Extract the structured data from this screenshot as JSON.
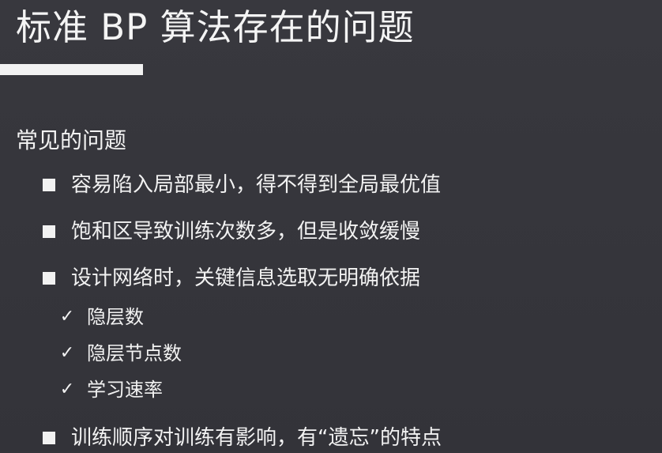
{
  "slide": {
    "title": "标准 BP 算法存在的问题",
    "section_heading": "常见的问题",
    "bullets": [
      {
        "text": "容易陷入局部最小，得不得到全局最优值"
      },
      {
        "text": "饱和区导致训练次数多，但是收敛缓慢"
      },
      {
        "text": "设计网络时，关键信息选取无明确依据"
      },
      {
        "text": "训练顺序对训练有影响，有“遗忘”的特点"
      }
    ],
    "sub_items": [
      {
        "mark": "✓",
        "text": "隐层数"
      },
      {
        "mark": "✓",
        "text": "隐层节点数"
      },
      {
        "mark": "✓",
        "text": "学习速率"
      }
    ]
  }
}
